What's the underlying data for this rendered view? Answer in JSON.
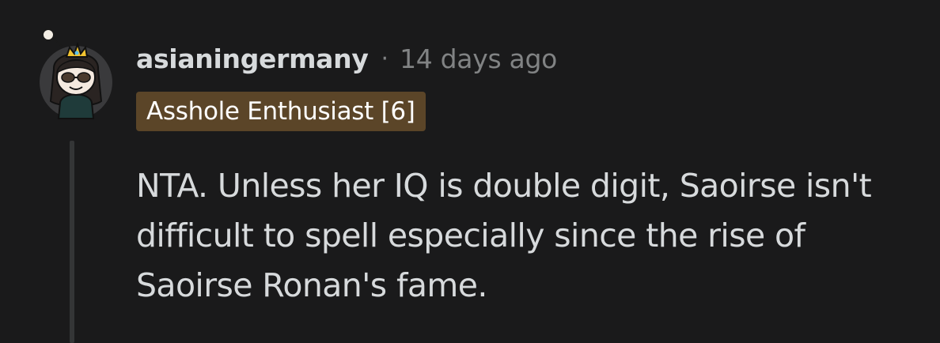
{
  "comment": {
    "username": "asianingermany",
    "separator": "·",
    "timestamp": "14 days ago",
    "flair": "Asshole Enthusiast [6]",
    "body": "NTA. Unless her IQ is double digit, Saoirse isn't difficult to spell especially since the rise of Saoirse Ronan's fame.",
    "avatar_icon": "snoo-avatar-icon"
  },
  "colors": {
    "background": "#1a1a1b",
    "text": "#d7dadc",
    "muted": "#818384",
    "flair_bg": "#5b4528",
    "thread_line": "#343536"
  }
}
